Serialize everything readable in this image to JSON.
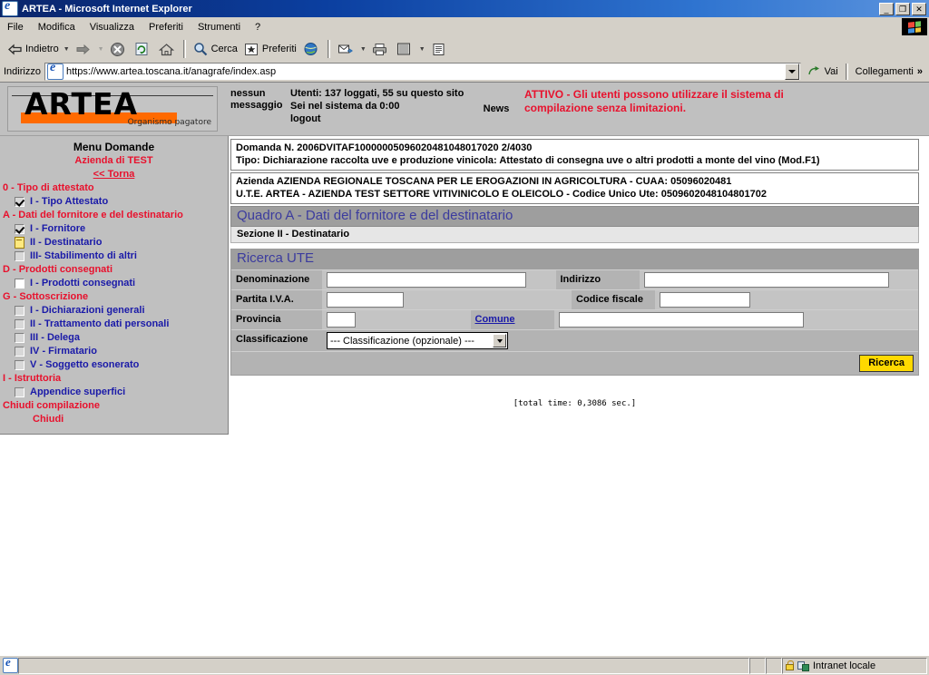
{
  "window": {
    "title": "ARTEA - Microsoft Internet Explorer",
    "icon": "ie-page-icon",
    "minimize_label": "_",
    "maximize_label": "❐",
    "close_label": "✕"
  },
  "menubar": {
    "items": [
      {
        "label": "File",
        "name": "menu-file"
      },
      {
        "label": "Modifica",
        "name": "menu-modifica"
      },
      {
        "label": "Visualizza",
        "name": "menu-visualizza"
      },
      {
        "label": "Preferiti",
        "name": "menu-preferiti"
      },
      {
        "label": "Strumenti",
        "name": "menu-strumenti"
      },
      {
        "label": "?",
        "name": "menu-help"
      }
    ]
  },
  "toolbar": {
    "back_label": "Indietro",
    "forward_label": "",
    "stop_label": "",
    "refresh_label": "",
    "home_label": "",
    "search_label": "Cerca",
    "favorites_label": "Preferiti",
    "history_label": "",
    "mail_label": "",
    "print_label": "",
    "edit_label": "",
    "discuss_label": ""
  },
  "address_bar": {
    "label": "Indirizzo",
    "url": "https://www.artea.toscana.it/anagrafe/index.asp",
    "go_label": "Vai",
    "links_label": "Collegamenti",
    "links_chevron": "»"
  },
  "site_header": {
    "logo_word": "ARTEA",
    "logo_subtitle": "Organismo pagatore",
    "message": "nessun messaggio",
    "users_line1": "Utenti: 137 loggati, 55 su questo sito",
    "users_line2": "Sei nel sistema da 0:00",
    "logout_label": "logout",
    "news_label": "News",
    "status_line1": "ATTIVO - Gli utenti possono utilizzare il sistema di",
    "status_line2": "compilazione senza limitazioni.",
    "status_color": "#e8112d"
  },
  "sidebar": {
    "title": "Menu Domande",
    "subtitle": "Azienda di TEST",
    "back_link": "<< Torna",
    "sections": [
      {
        "group": "0 - Tipo di attestato",
        "items": [
          {
            "icon": "checkbox-checked-icon",
            "label": "I - Tipo Attestato",
            "name": "sidebar-item-tipo-attestato"
          }
        ]
      },
      {
        "group": "A - Dati del fornitore e del destinatario",
        "items": [
          {
            "icon": "checkbox-checked-icon",
            "label": "I - Fornitore",
            "name": "sidebar-item-fornitore"
          },
          {
            "icon": "document-icon",
            "label": "II - Destinatario",
            "name": "sidebar-item-destinatario"
          },
          {
            "icon": "checkbox-empty-icon",
            "label": "III- Stabilimento di altri",
            "name": "sidebar-item-stabilimento-altri"
          }
        ]
      },
      {
        "group": "D - Prodotti consegnati",
        "items": [
          {
            "icon": "checkbox-white-icon",
            "label": "I - Prodotti consegnati",
            "name": "sidebar-item-prodotti-consegnati"
          }
        ]
      },
      {
        "group": "G - Sottoscrizione",
        "items": [
          {
            "icon": "checkbox-empty-icon",
            "label": "I - Dichiarazioni generali",
            "name": "sidebar-item-dichiarazioni-generali"
          },
          {
            "icon": "checkbox-empty-icon",
            "label": "II - Trattamento dati personali",
            "name": "sidebar-item-trattamento-dati"
          },
          {
            "icon": "checkbox-empty-icon",
            "label": "III - Delega",
            "name": "sidebar-item-delega"
          },
          {
            "icon": "checkbox-empty-icon",
            "label": "IV - Firmatario",
            "name": "sidebar-item-firmatario"
          },
          {
            "icon": "checkbox-empty-icon",
            "label": "V - Soggetto esonerato",
            "name": "sidebar-item-soggetto-esonerato"
          }
        ]
      },
      {
        "group": "I - Istruttoria",
        "items": [
          {
            "icon": "checkbox-empty-icon",
            "label": "Appendice superfici",
            "name": "sidebar-item-appendice-superfici"
          }
        ]
      }
    ],
    "close_group": "Chiudi compilazione",
    "close_link": "Chiudi"
  },
  "main": {
    "domanda_line": "Domanda N. 2006DVITAF10000005096020481048017020 2/4030",
    "tipo_line": "Tipo: Dichiarazione raccolta uve e produzione vinicola: Attestato di consegna uve o altri prodotti a monte del vino (Mod.F1)",
    "azienda_line": "Azienda AZIENDA REGIONALE TOSCANA PER LE EROGAZIONI IN AGRICOLTURA - CUAA: 05096020481",
    "ute_line": "U.T.E. ARTEA - AZIENDA TEST SETTORE VITIVINICOLO E OLEICOLO - Codice Unico Ute: 0509602048104801702",
    "quadro_title": "Quadro A - Dati del fornitore e del destinatario",
    "sezione_title": "Sezione II - Destinatario",
    "panel_title": "Ricerca UTE",
    "fields": {
      "denominazione_label": "Denominazione",
      "denominazione_value": "",
      "indirizzo_label": "Indirizzo",
      "indirizzo_value": "",
      "partita_iva_label": "Partita I.V.A.",
      "partita_iva_value": "",
      "codice_fiscale_label": "Codice fiscale",
      "codice_fiscale_value": "",
      "provincia_label": "Provincia",
      "provincia_value": "",
      "comune_label": "Comune",
      "comune_value": "",
      "classificazione_label": "Classificazione",
      "classificazione_selected": "--- Classificazione (opzionale) ---"
    },
    "search_button": "Ricerca",
    "total_time": "[total time: 0,3086 sec.]"
  },
  "statusbar": {
    "message": "",
    "zone": "Intranet locale"
  }
}
